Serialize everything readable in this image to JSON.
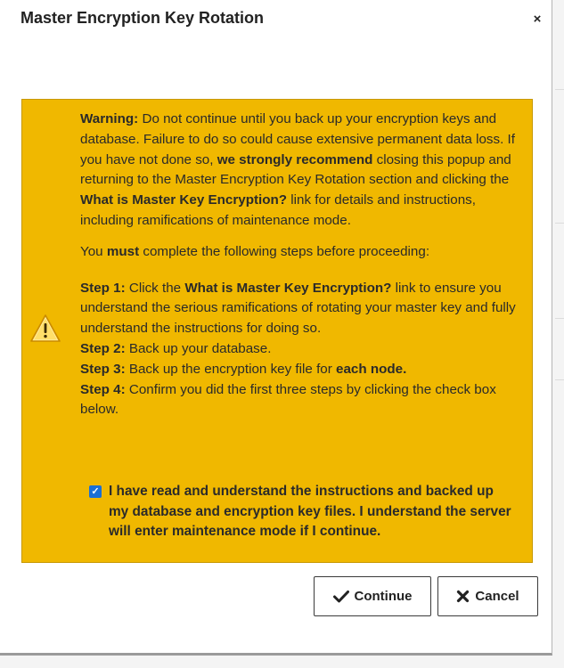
{
  "dialog": {
    "title": "Master Encryption Key Rotation",
    "close_icon": "×"
  },
  "warning": {
    "icon": "warning-triangle",
    "p1": {
      "t1": "Warning:",
      "t2": " Do not continue until you back up your encryption keys and database. Failure to do so could cause extensive permanent data loss. If you have not done so, ",
      "t3": "we strongly recommend",
      "t4": " closing this popup and returning to the Master Encryption Key Rotation section and clicking the ",
      "t5": "What is Master Key Encryption?",
      "t6": " link for details and instructions, including ramifications of maintenance mode."
    },
    "p2": {
      "t1": "You ",
      "t2": "must",
      "t3": " complete the following steps before proceeding:"
    },
    "steps": {
      "s1_label": "Step 1:",
      "s1_a": " Click the ",
      "s1_b": "What is Master Key Encryption?",
      "s1_c": " link to ensure you understand the serious ramifications of rotating your master key and fully understand the instructions for doing so.",
      "s2_label": "Step 2:",
      "s2_text": " Back up your database.",
      "s3_label": "Step 3:",
      "s3_a": " Back up the encryption key file for ",
      "s3_b": "each node.",
      "s4_label": "Step 4:",
      "s4_text": " Confirm you did the first three steps by clicking the check box below."
    },
    "confirm": {
      "checked": true,
      "label": "I have read and understand the instructions and backed up my database and encryption key files. I understand the server will enter maintenance mode if I continue."
    }
  },
  "buttons": {
    "continue_label": "Continue",
    "cancel_label": "Cancel"
  },
  "colors": {
    "warning_bg": "#f0b800",
    "checkbox": "#1a6fd6"
  }
}
